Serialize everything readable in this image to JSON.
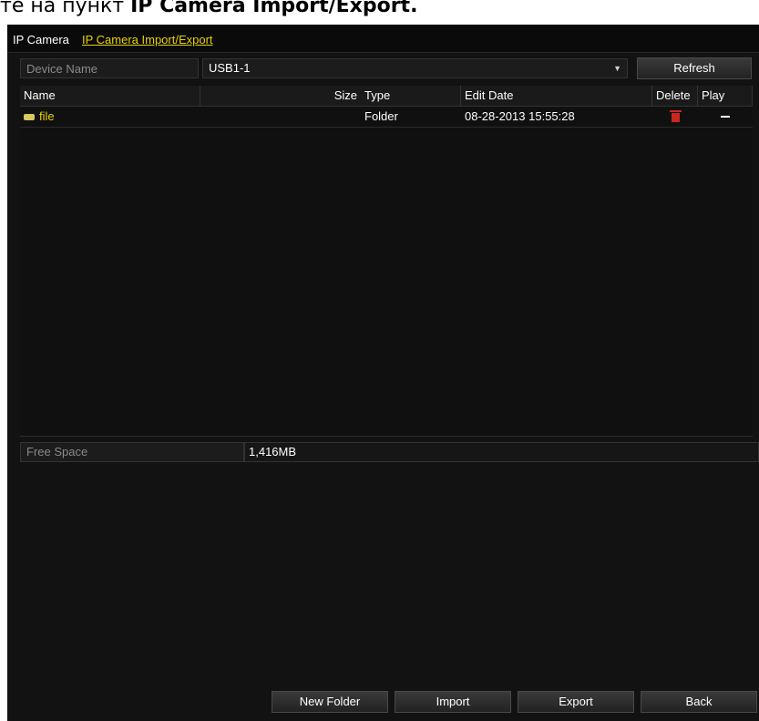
{
  "heading": {
    "prefix": "те на пункт ",
    "bold": "IP Camera Import/Export."
  },
  "tabs": [
    {
      "label": "IP Camera"
    },
    {
      "label": "IP Camera Import/Export"
    }
  ],
  "device": {
    "label": "Device Name",
    "value": "USB1-1",
    "refresh_label": "Refresh"
  },
  "table": {
    "columns": [
      "Name",
      "Size",
      "Type",
      "Edit Date",
      "Delete",
      "Play"
    ],
    "rows": [
      {
        "name": "file",
        "size": "",
        "type": "Folder",
        "edit_date": "08-28-2013 15:55:28",
        "icon": "folder-icon",
        "delete_icon": "trash-icon",
        "play": "dash"
      }
    ]
  },
  "free_space": {
    "label": "Free Space",
    "value": "1,416MB"
  },
  "buttons": {
    "new_folder": "New Folder",
    "import": "Import",
    "export": "Export",
    "back": "Back"
  },
  "colors": {
    "accent": "#e8d200",
    "panel_bg": "#121212",
    "delete_red": "#c8281e"
  }
}
